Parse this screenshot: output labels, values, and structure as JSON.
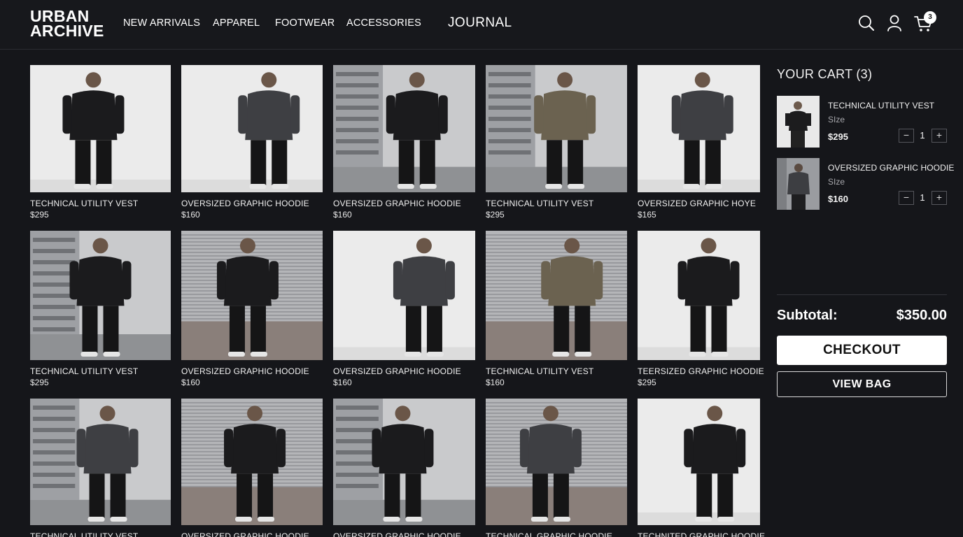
{
  "brand": {
    "line1": "URBAN",
    "line2": "ARCHIVE"
  },
  "nav": {
    "items": [
      {
        "label": "NEW ARRIVALS"
      },
      {
        "label": "APPAREL"
      },
      {
        "label": "FOOTWEAR"
      },
      {
        "label": "ACCESSORIES"
      },
      {
        "label": "JOURNAL"
      }
    ]
  },
  "header_icons": {
    "search": "search-icon",
    "account": "user-icon",
    "cart": "cart-icon",
    "cart_count": "3"
  },
  "products": [
    {
      "name": "TECHNICAL UTILITY VEST",
      "price": "$295",
      "photo": "white-studio"
    },
    {
      "name": "OVERSIZED GRAPHIC HOODIE",
      "price": "$160",
      "photo": "white-studio"
    },
    {
      "name": "OVERSIZED GRAPHIC HOODIE",
      "price": "$160",
      "photo": "street"
    },
    {
      "name": "TECHNICAL UTILITY VEST",
      "price": "$295",
      "photo": "street"
    },
    {
      "name": "OVERSIZED GRAPHIC HOYE",
      "price": "$165",
      "photo": "white-studio"
    },
    {
      "name": "TECHNICAL UTILITY VEST",
      "price": "$295",
      "photo": "street"
    },
    {
      "name": "OVERSIZED GRAPHIC HOODIE",
      "price": "$160",
      "photo": "shutter"
    },
    {
      "name": "OVERSIZED GRAPHIC HOODIE",
      "price": "$160",
      "photo": "white-studio"
    },
    {
      "name": "TECHNICAL UTILITY VEST",
      "price": "$160",
      "photo": "shutter"
    },
    {
      "name": "TEERSIZED GRAPHIC HOODIE",
      "price": "$295",
      "photo": "white-studio"
    },
    {
      "name": "TECHNICAL UTILITY VEST",
      "price": "",
      "photo": "street"
    },
    {
      "name": "OVERSIZED GRAPHIC HOODIE",
      "price": "",
      "photo": "shutter"
    },
    {
      "name": "OVERSIZED GRAPHIC HOODIE",
      "price": "",
      "photo": "street"
    },
    {
      "name": "TECHNICAL GRAPHIC HOODIE",
      "price": "",
      "photo": "shutter"
    },
    {
      "name": "TECHNITED GRAPHIC HOODIE",
      "price": "",
      "photo": "white-studio"
    }
  ],
  "cart": {
    "title": "YOUR CART (3)",
    "items": [
      {
        "name": "TECHNICAL UTILITY VEST",
        "size_label": "SIze",
        "price": "$295",
        "qty": "1"
      },
      {
        "name": "OVERSIZED GRAPHIC HOODIE",
        "size_label": "SIze",
        "price": "$160",
        "qty": "1"
      }
    ],
    "qty_minus": "−",
    "qty_plus": "+",
    "subtotal_label": "Subtotal:",
    "subtotal_value": "$350.00",
    "checkout_label": "CHECKOUT",
    "view_bag_label": "VIEW BAG"
  },
  "colors": {
    "background": "#15161a",
    "header": "#17181c",
    "text": "#ffffff",
    "muted": "#a8a8ad",
    "button_bg": "#ffffff"
  }
}
